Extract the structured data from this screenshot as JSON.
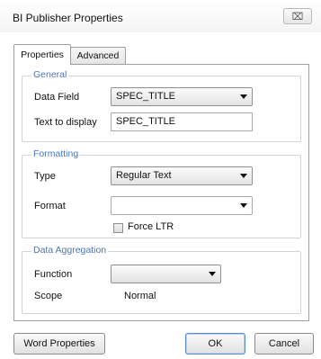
{
  "window": {
    "title": "BI Publisher Properties",
    "close_glyph": "⌧"
  },
  "tabs": [
    {
      "label": "Properties",
      "active": true
    },
    {
      "label": "Advanced",
      "active": false
    }
  ],
  "general": {
    "legend": "General",
    "data_field_label": "Data Field",
    "data_field_value": "SPEC_TITLE",
    "text_to_display_label": "Text to display",
    "text_to_display_value": "SPEC_TITLE"
  },
  "formatting": {
    "legend": "Formatting",
    "type_label": "Type",
    "type_value": "Regular Text",
    "format_label": "Format",
    "format_value": "",
    "force_ltr_label": "Force LTR",
    "force_ltr_checked": false
  },
  "data_aggregation": {
    "legend": "Data Aggregation",
    "function_label": "Function",
    "function_value": "",
    "scope_label": "Scope",
    "scope_value": "Normal"
  },
  "buttons": {
    "word_properties": "Word Properties",
    "ok": "OK",
    "cancel": "Cancel"
  },
  "colors": {
    "legend_text": "#4a77b6",
    "default_button_border": "#5b87c4"
  }
}
